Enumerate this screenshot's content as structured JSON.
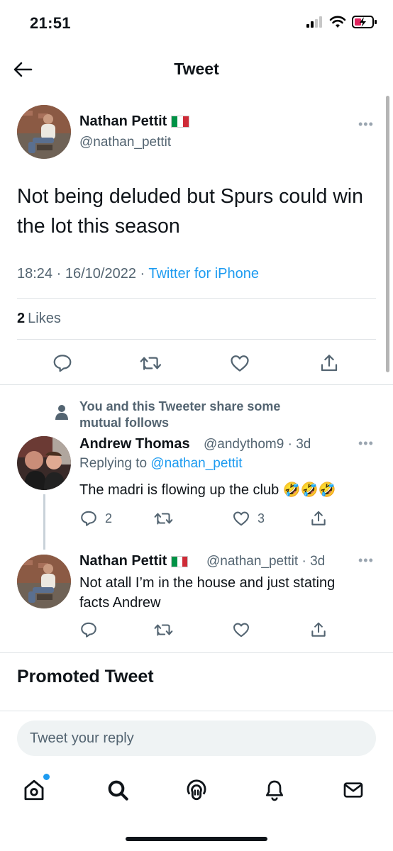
{
  "status_bar": {
    "time": "21:51"
  },
  "header": {
    "title": "Tweet"
  },
  "main_tweet": {
    "author_name": "Nathan Pettit",
    "author_flag": "italy-flag",
    "author_handle": "@nathan_pettit",
    "text": "Not being deluded but Spurs could win the lot this season",
    "time": "18:24",
    "date": "16/10/2022",
    "source": "Twitter for iPhone",
    "likes_count": "2",
    "likes_label": "Likes",
    "more": "•••"
  },
  "mutual_follows_note": "You and this Tweeter share some mutual follows",
  "replies": [
    {
      "author_name": "Andrew Thomas",
      "author_handle": "@andythom9",
      "age": "3d",
      "replying_to_label": "Replying to",
      "replying_to_handle": "@nathan_pettit",
      "text": "The madri is flowing up the club 🤣🤣🤣",
      "reply_count": "2",
      "retweet_count": "",
      "like_count": "3",
      "more": "•••"
    },
    {
      "author_name": "Nathan Pettit",
      "author_flag": "italy-flag",
      "author_handle": "@nathan_pettit",
      "age": "3d",
      "text_line1": "Not atall I’m in the house and just stating",
      "text_line2": "facts Andrew",
      "more": "•••"
    }
  ],
  "promoted_label": "Promoted Tweet",
  "composer": {
    "placeholder": "Tweet your reply"
  },
  "tab_bar": [
    "home-icon",
    "search-icon",
    "spaces-icon",
    "notifications-icon",
    "messages-icon"
  ],
  "colors": {
    "link": "#1d9bf0",
    "secondary_text": "#536471",
    "primary_text": "#0f1419"
  }
}
